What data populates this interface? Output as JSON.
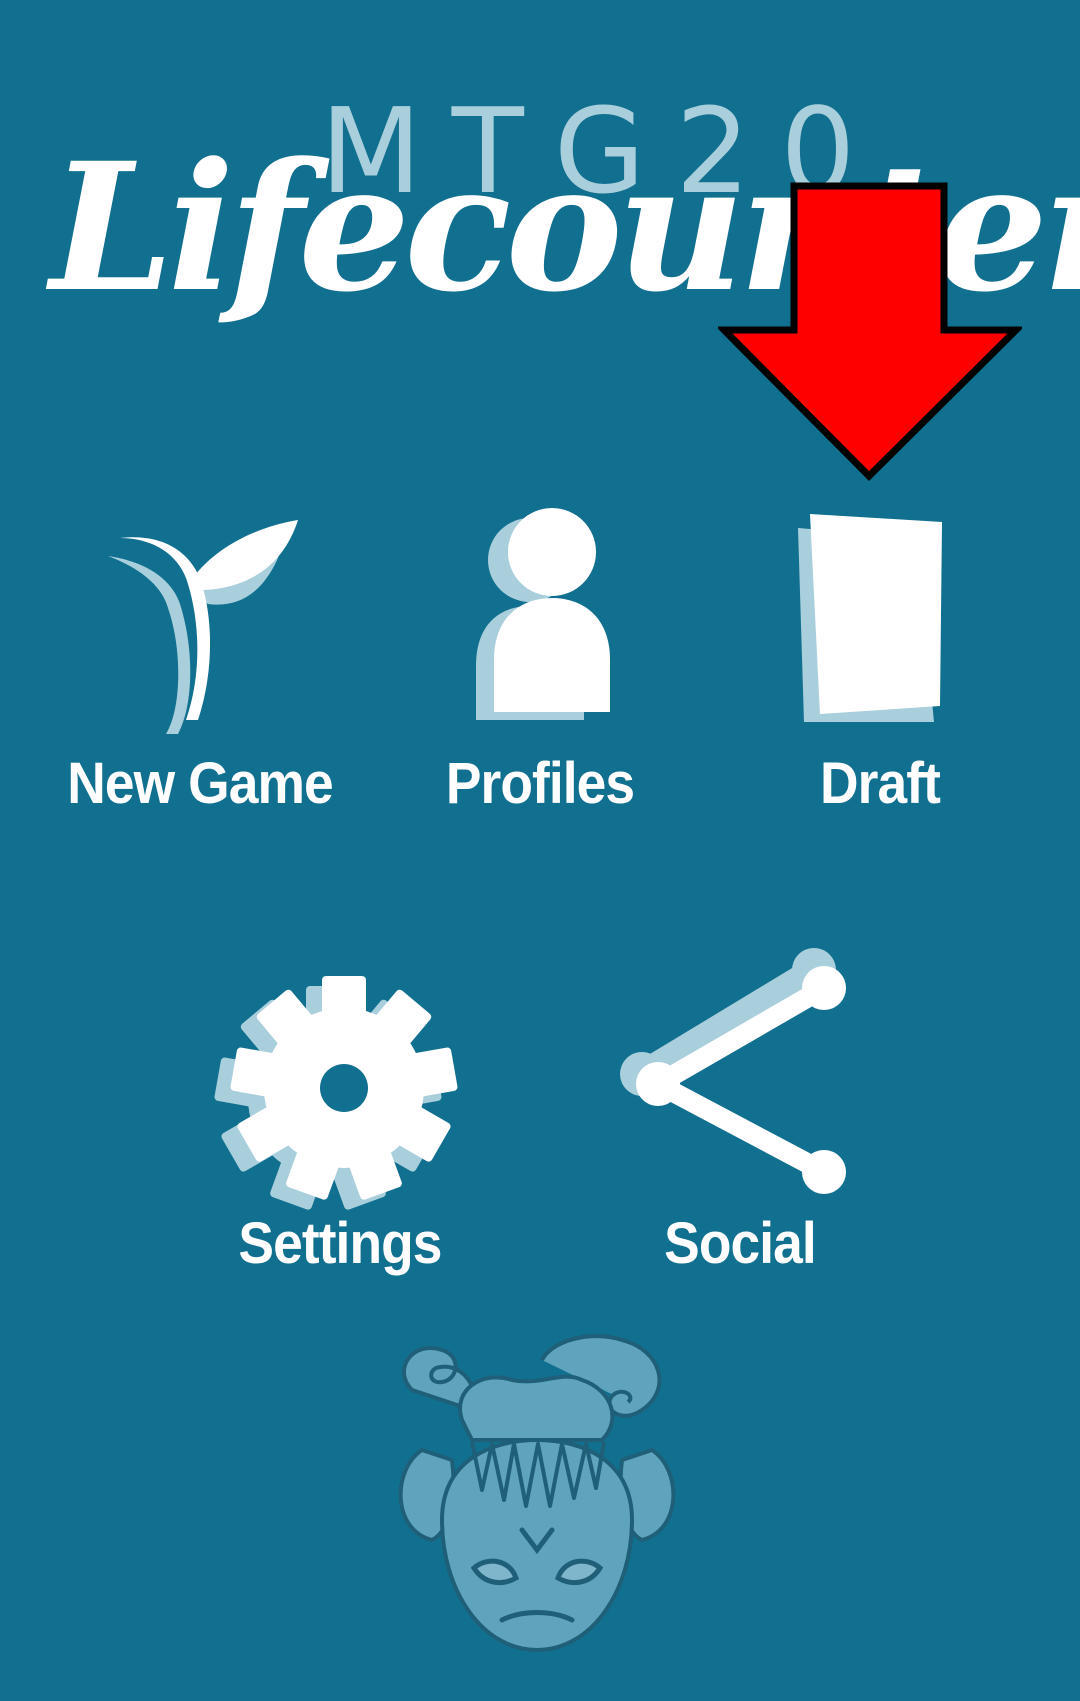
{
  "logo": {
    "subtitle": "MTG20",
    "title": "Lifecounter"
  },
  "annotation": {
    "icon": "down-arrow-icon",
    "color": "#ff0000"
  },
  "menu": {
    "items": [
      {
        "label": "New Game",
        "icon": "sprout-icon"
      },
      {
        "label": "Profiles",
        "icon": "person-icon"
      },
      {
        "label": "Draft",
        "icon": "card-icon"
      },
      {
        "label": "Settings",
        "icon": "gear-icon"
      },
      {
        "label": "Social",
        "icon": "share-icon"
      }
    ]
  },
  "mascot": {
    "icon": "goblin-face-icon"
  },
  "colors": {
    "background": "#11708f",
    "icon": "#ffffff",
    "icon_shadow": "#a9cfdc",
    "mascot": "#5fa3bd"
  }
}
